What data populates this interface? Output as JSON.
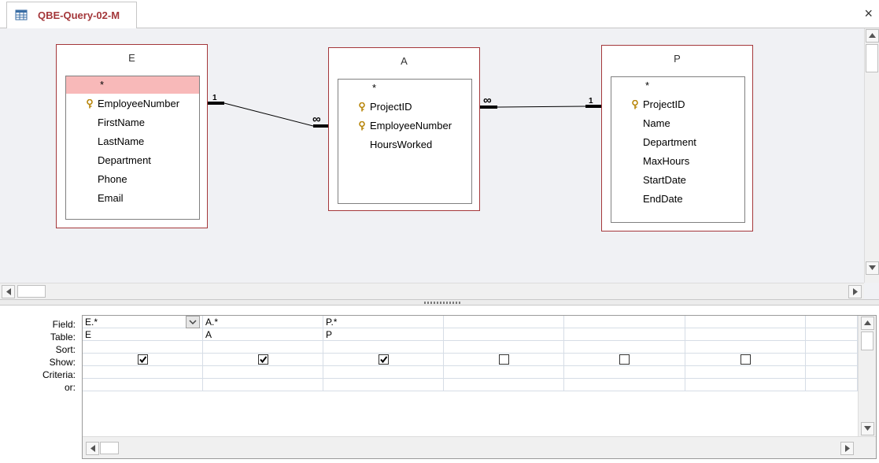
{
  "tab": {
    "title": "QBE-Query-02-M",
    "close_symbol": "×",
    "accent_color": "#a4373a"
  },
  "tables": [
    {
      "name": "E",
      "fields": [
        {
          "name": "*",
          "key": false,
          "selected": true
        },
        {
          "name": "EmployeeNumber",
          "key": true,
          "selected": false
        },
        {
          "name": "FirstName",
          "key": false,
          "selected": false
        },
        {
          "name": "LastName",
          "key": false,
          "selected": false
        },
        {
          "name": "Department",
          "key": false,
          "selected": false
        },
        {
          "name": "Phone",
          "key": false,
          "selected": false
        },
        {
          "name": "Email",
          "key": false,
          "selected": false
        }
      ]
    },
    {
      "name": "A",
      "fields": [
        {
          "name": "*",
          "key": false,
          "selected": false
        },
        {
          "name": "ProjectID",
          "key": true,
          "selected": false
        },
        {
          "name": "EmployeeNumber",
          "key": true,
          "selected": false
        },
        {
          "name": "HoursWorked",
          "key": false,
          "selected": false
        }
      ]
    },
    {
      "name": "P",
      "fields": [
        {
          "name": "*",
          "key": false,
          "selected": false
        },
        {
          "name": "ProjectID",
          "key": true,
          "selected": false
        },
        {
          "name": "Name",
          "key": false,
          "selected": false
        },
        {
          "name": "Department",
          "key": false,
          "selected": false
        },
        {
          "name": "MaxHours",
          "key": false,
          "selected": false
        },
        {
          "name": "StartDate",
          "key": false,
          "selected": false
        },
        {
          "name": "EndDate",
          "key": false,
          "selected": false
        }
      ]
    }
  ],
  "relationships": [
    {
      "from": "E",
      "to": "A",
      "from_label": "1",
      "to_label": "∞"
    },
    {
      "from": "A",
      "to": "P",
      "from_label": "∞",
      "to_label": "1"
    }
  ],
  "grid": {
    "row_labels": [
      "Field:",
      "Table:",
      "Sort:",
      "Show:",
      "Criteria:",
      "or:"
    ],
    "columns": [
      {
        "field": "E.*",
        "table": "E",
        "sort": "",
        "show": true,
        "criteria": "",
        "or": ""
      },
      {
        "field": "A.*",
        "table": "A",
        "sort": "",
        "show": true,
        "criteria": "",
        "or": ""
      },
      {
        "field": "P.*",
        "table": "P",
        "sort": "",
        "show": true,
        "criteria": "",
        "or": ""
      },
      {
        "field": "",
        "table": "",
        "sort": "",
        "show": false,
        "criteria": "",
        "or": ""
      },
      {
        "field": "",
        "table": "",
        "sort": "",
        "show": false,
        "criteria": "",
        "or": ""
      },
      {
        "field": "",
        "table": "",
        "sort": "",
        "show": false,
        "criteria": "",
        "or": ""
      },
      {
        "field": "",
        "table": "",
        "sort": "",
        "show": false,
        "criteria": "",
        "or": ""
      }
    ]
  }
}
